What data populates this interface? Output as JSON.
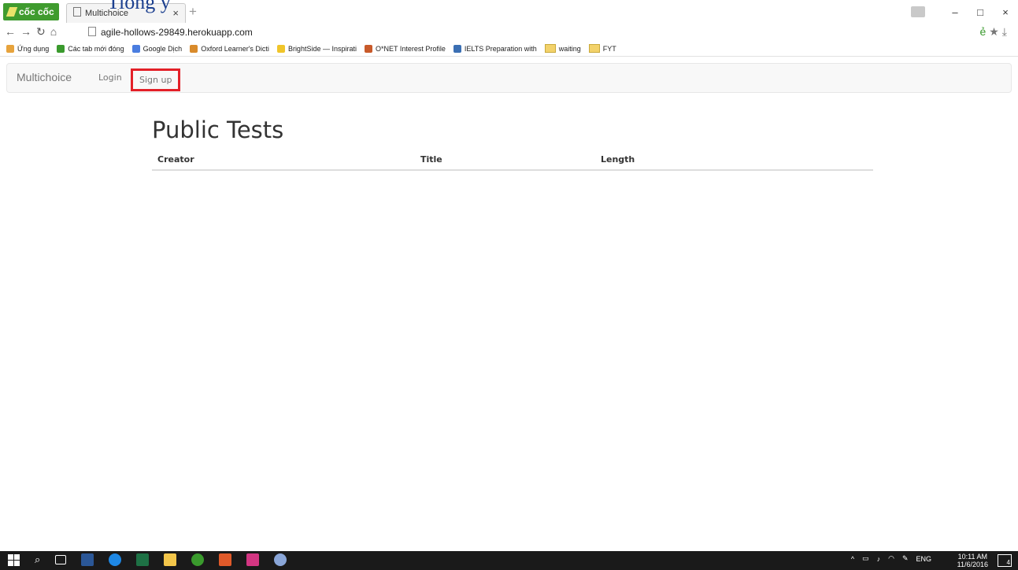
{
  "artifact_text": "Tiống y",
  "browser": {
    "brand": "cốc cốc",
    "tab_title": "Multichoice",
    "tab_close": "×",
    "new_tab": "+",
    "url": "agile-hollows-29849.herokuapp.com",
    "window_controls": [
      "–",
      "□",
      "×"
    ],
    "bookmarks": [
      {
        "label": "Ứng dụng",
        "icon": "apps-grid-icon",
        "color": "#e7a33c"
      },
      {
        "label": "Các tab mới đóng",
        "icon": "history-icon",
        "color": "#3a9a2d"
      },
      {
        "label": "Google Dịch",
        "icon": "google-translate-icon",
        "color": "#4a7de0"
      },
      {
        "label": "Oxford Learner's Dicti",
        "icon": "oxford-icon",
        "color": "#d98b2b"
      },
      {
        "label": "BrightSide — Inspirati",
        "icon": "brightside-icon",
        "color": "#f0c52a"
      },
      {
        "label": "O*NET Interest Profile",
        "icon": "onet-icon",
        "color": "#c85a2a"
      },
      {
        "label": "IELTS Preparation with",
        "icon": "ielts-icon",
        "color": "#3b6fb3"
      },
      {
        "label": "waiting",
        "icon": "folder-icon",
        "color": "#f3d26a"
      },
      {
        "label": "FYT",
        "icon": "folder-icon",
        "color": "#f3d26a"
      }
    ]
  },
  "navbar": {
    "brand": "Multichoice",
    "login": "Login",
    "signup": "Sign up"
  },
  "main": {
    "title": "Public Tests",
    "columns": [
      "Creator",
      "Title",
      "Length"
    ]
  },
  "taskbar": {
    "lang": "ENG",
    "time": "10:11 AM",
    "date": "11/6/2016",
    "notification_count": "4"
  }
}
